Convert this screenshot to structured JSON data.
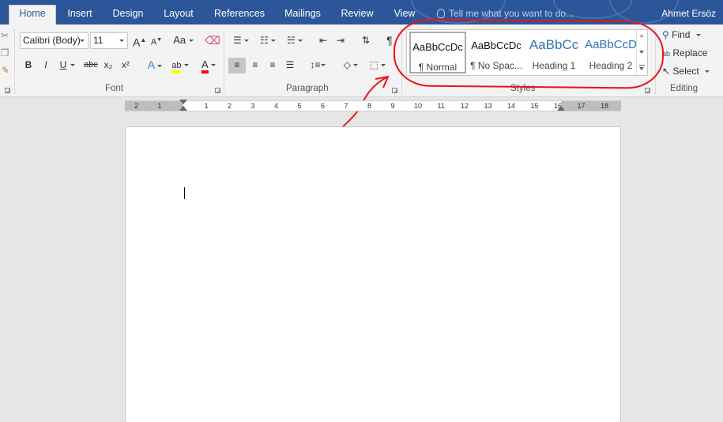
{
  "tabs": [
    {
      "label": "Home",
      "active": true
    },
    {
      "label": "Insert"
    },
    {
      "label": "Design"
    },
    {
      "label": "Layout"
    },
    {
      "label": "References"
    },
    {
      "label": "Mailings"
    },
    {
      "label": "Review"
    },
    {
      "label": "View"
    }
  ],
  "tell_me": "Tell me what you want to do...",
  "user_name": "Ahmet Ersöz",
  "font": {
    "family": "Calibri (Body)",
    "size": "11",
    "group_label": "Font",
    "grow": "A",
    "shrink": "A",
    "change_case": "Aa",
    "bold": "B",
    "italic": "I",
    "underline": "U",
    "strike": "abc",
    "subscript": "x₂",
    "superscript": "x²",
    "text_effects": "A",
    "highlight": "ab",
    "font_color": "A"
  },
  "paragraph": {
    "group_label": "Paragraph",
    "pilcrow": "¶"
  },
  "styles": {
    "group_label": "Styles",
    "items": [
      {
        "preview": "AaBbCcDc",
        "name": "¶ Normal"
      },
      {
        "preview": "AaBbCcDc",
        "name": "¶ No Spac..."
      },
      {
        "preview": "AaBbCc",
        "name": "Heading 1"
      },
      {
        "preview": "AaBbCcD",
        "name": "Heading 2"
      }
    ]
  },
  "editing": {
    "group_label": "Editing",
    "find": "Find",
    "replace": "Replace",
    "select": "Select"
  },
  "ruler_numbers": [
    "2",
    "1",
    "1",
    "2",
    "3",
    "4",
    "5",
    "6",
    "7",
    "8",
    "9",
    "10",
    "11",
    "12",
    "13",
    "14",
    "15",
    "16",
    "17",
    "18"
  ],
  "colors": {
    "brand": "#2b579a",
    "annotation": "#e8141a",
    "highlight": "#ffff00",
    "font_color": "#ff0000"
  }
}
